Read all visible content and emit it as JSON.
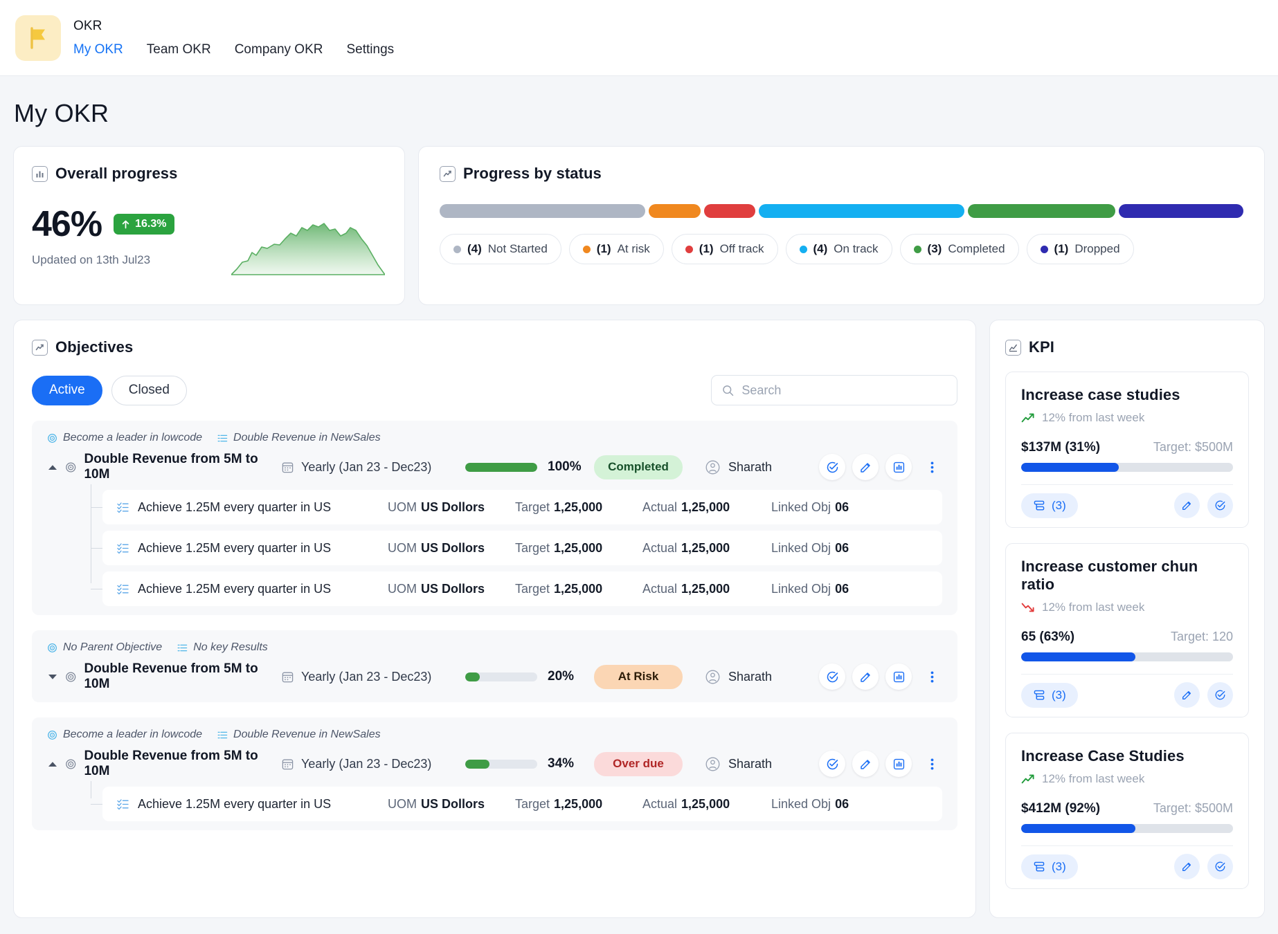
{
  "header": {
    "brand": "OKR",
    "logo_icon": "flag-icon",
    "nav": [
      {
        "label": "My OKR",
        "active": true
      },
      {
        "label": "Team OKR",
        "active": false
      },
      {
        "label": "Company OKR",
        "active": false
      },
      {
        "label": "Settings",
        "active": false
      }
    ]
  },
  "page_title": "My OKR",
  "overall_progress": {
    "title": "Overall progress",
    "icon": "bar-chart-icon",
    "percent": "46%",
    "delta": "16.3%",
    "delta_icon": "arrow-up-icon",
    "delta_color": "#2ba33f",
    "updated": "Updated on 13th Jul23"
  },
  "progress_by_status": {
    "title": "Progress by status",
    "icon": "trend-line-icon",
    "segments": [
      {
        "label": "Not Started",
        "count": "(4)",
        "color": "#aeb6c4",
        "weight": 28
      },
      {
        "label": "At risk",
        "count": "(1)",
        "color": "#f0881f",
        "weight": 7
      },
      {
        "label": "Off track",
        "count": "(1)",
        "color": "#e03e3e",
        "weight": 7
      },
      {
        "label": "On track",
        "count": "(4)",
        "color": "#14aff1",
        "weight": 28
      },
      {
        "label": "Completed",
        "count": "(3)",
        "color": "#3f9c45",
        "weight": 20
      },
      {
        "label": "Dropped",
        "count": "(1)",
        "color": "#2f2bb0",
        "weight": 17
      }
    ]
  },
  "objectives": {
    "title": "Objectives",
    "icon": "trend-line-icon",
    "tabs": [
      {
        "label": "Active",
        "active": true
      },
      {
        "label": "Closed",
        "active": false
      }
    ],
    "search": {
      "placeholder": "Search",
      "value": ""
    },
    "columns": {
      "uom": "UOM",
      "target": "Target",
      "actual": "Actual",
      "linked": "Linked Obj"
    },
    "groups": [
      {
        "parent": "Become a leader in lowcode",
        "keyresult_tag": "Double Revenue in NewSales",
        "expanded": true,
        "name": "Double Revenue from 5M to 10M",
        "cycle": "Yearly (Jan 23 - Dec23)",
        "percent": "100%",
        "progress": 100,
        "status": "Completed",
        "status_bg": "#d4f2d7",
        "status_fg": "#17502a",
        "owner": "Sharath",
        "key_results": [
          {
            "name": "Achieve 1.25M every quarter in US",
            "uom": "US Dollors",
            "target": "1,25,000",
            "actual": "1,25,000",
            "linked": "06"
          },
          {
            "name": "Achieve 1.25M every quarter in US",
            "uom": "US Dollors",
            "target": "1,25,000",
            "actual": "1,25,000",
            "linked": "06"
          },
          {
            "name": "Achieve 1.25M every quarter in US",
            "uom": "US Dollors",
            "target": "1,25,000",
            "actual": "1,25,000",
            "linked": "06"
          }
        ]
      },
      {
        "parent": "No Parent Objective",
        "keyresult_tag": "No key Results",
        "expanded": false,
        "name": "Double Revenue from 5M to 10M",
        "cycle": "Yearly (Jan 23 - Dec23)",
        "percent": "20%",
        "progress": 20,
        "status": "At Risk",
        "status_bg": "#fbd6b4",
        "status_fg": "#2c1c08",
        "owner": "Sharath",
        "key_results": []
      },
      {
        "parent": "Become a leader in lowcode",
        "keyresult_tag": "Double Revenue in NewSales",
        "expanded": true,
        "name": "Double Revenue from 5M to 10M",
        "cycle": "Yearly (Jan 23 - Dec23)",
        "percent": "34%",
        "progress": 34,
        "status": "Over due",
        "status_bg": "#fbdada",
        "status_fg": "#b02626",
        "owner": "Sharath",
        "key_results": [
          {
            "name": "Achieve 1.25M every quarter in US",
            "uom": "US Dollors",
            "target": "1,25,000",
            "actual": "1,25,000",
            "linked": "06"
          }
        ]
      }
    ]
  },
  "kpi": {
    "title": "KPI",
    "icon": "kpi-chart-icon",
    "cards": [
      {
        "title": "Increase case studies",
        "trend": "12% from last week",
        "trend_dir": "up",
        "value": "$137M (31%)",
        "target": "Target:  $500M",
        "progress": 46,
        "link_count": "(3)"
      },
      {
        "title": "Increase customer chun ratio",
        "trend": "12% from last week",
        "trend_dir": "down",
        "value": "65 (63%)",
        "target": "Target:  120",
        "progress": 54,
        "link_count": "(3)"
      },
      {
        "title": "Increase Case Studies",
        "trend": "12% from last week",
        "trend_dir": "up",
        "value": "$412M (92%)",
        "target": "Target:  $500M",
        "progress": 54,
        "link_count": "(3)"
      }
    ]
  }
}
